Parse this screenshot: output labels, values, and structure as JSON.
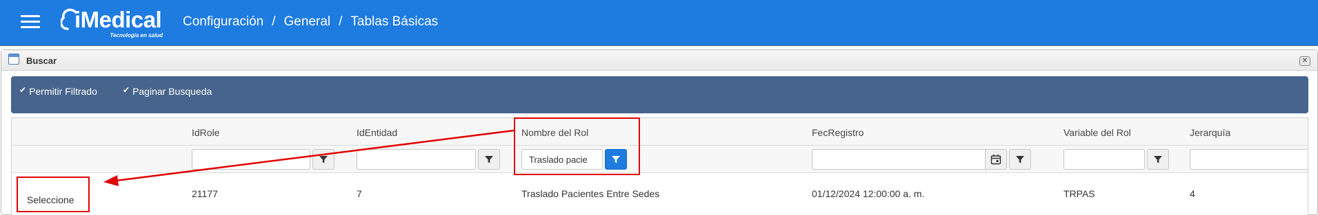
{
  "header": {
    "logo_text": "iMedical",
    "logo_tagline": "Tecnología en salud",
    "breadcrumb": [
      "Configuración",
      "General",
      "Tablas Básicas"
    ],
    "separator": "/"
  },
  "panel": {
    "title": "Buscar",
    "close_glyph": "✕"
  },
  "options": {
    "filter_label": "Permitir Filtrado",
    "filter_checked": true,
    "paging_label": "Paginar Busqueda",
    "paging_checked": true,
    "check_glyph": "✔"
  },
  "grid": {
    "columns": [
      "IdRole",
      "IdEntidad",
      "Nombre del Rol",
      "FecRegistro",
      "Variable del Rol",
      "Jerarquía"
    ],
    "filters": {
      "idrole": "",
      "identidad": "",
      "nombre": "Traslado pacie",
      "fecregistro": "",
      "variable": "",
      "jerarquia": ""
    },
    "rows": [
      {
        "action": "Seleccione",
        "idrole": "21177",
        "identidad": "7",
        "nombre": "Traslado Pacientes Entre Sedes",
        "fecregistro": "01/12/2024 12:00:00 a. m.",
        "variable": "TRPAS",
        "jerarquia": "4"
      }
    ]
  },
  "colors": {
    "header_bg": "#1e7be0",
    "options_bg": "#46648c",
    "annotation": "#e00000",
    "active_filter": "#1e7be0"
  },
  "icons": {
    "menu": "hamburger-icon",
    "filter": "funnel-icon",
    "calendar": "calendar-icon",
    "close": "close-icon",
    "window": "window-icon"
  }
}
